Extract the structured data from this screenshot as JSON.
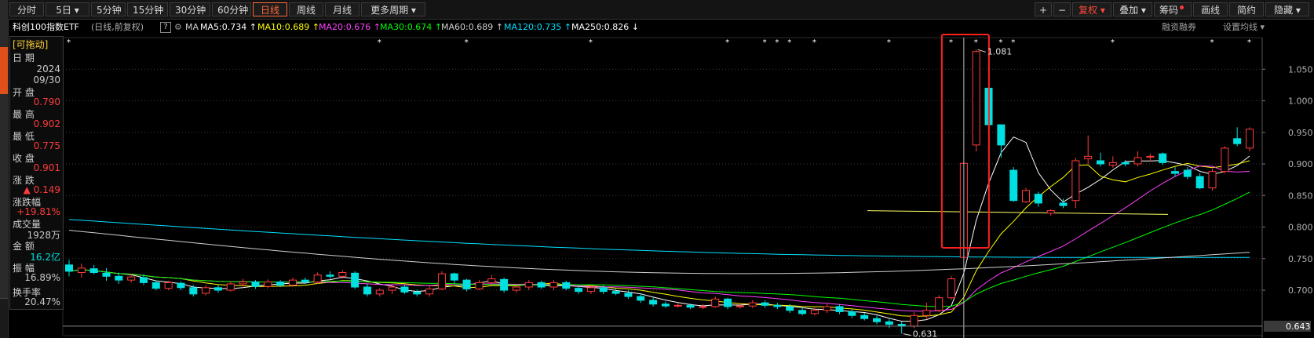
{
  "toolbar": {
    "tabs": [
      {
        "label": "分时"
      },
      {
        "label": "5日 ▾"
      },
      {
        "label": "5分钟"
      },
      {
        "label": "15分钟"
      },
      {
        "label": "30分钟"
      },
      {
        "label": "60分钟"
      },
      {
        "label": "日线",
        "active": true
      },
      {
        "label": "周线"
      },
      {
        "label": "月线"
      },
      {
        "label": "更多周期 ▾"
      }
    ],
    "right": {
      "plus": "+",
      "minus": "−",
      "fuquan": "复权 ▾",
      "diejia": "叠加 ▾",
      "chouma": "筹码",
      "huaxian": "画线",
      "jianyue": "简约",
      "yincang": "隐藏 ▾"
    }
  },
  "ma_line": {
    "title": "科创100指数ETF",
    "subtitle": "(日线,前复权)",
    "help": "?",
    "ma": "MA",
    "items": [
      {
        "text": "MA5:0.734",
        "arrow": "↑",
        "color": "#ffffff"
      },
      {
        "text": "MA10:0.689",
        "arrow": "↑",
        "color": "#ffff00"
      },
      {
        "text": "MA20:0.676",
        "arrow": "↑",
        "color": "#ff40ff"
      },
      {
        "text": "MA30:0.674",
        "arrow": "↑",
        "color": "#00ff00"
      },
      {
        "text": "MA60:0.689",
        "arrow": "↑",
        "color": "#d0d0d0"
      },
      {
        "text": "MA120:0.735",
        "arrow": "↑",
        "color": "#00e0ff"
      },
      {
        "text": "MA250:0.826",
        "arrow": "↓",
        "color": "#ffffff"
      }
    ],
    "rzrq": "融资融券",
    "setma": "设置均线 ▾"
  },
  "info": {
    "drag": "[可拖动]",
    "date_label": "日  期",
    "year": "2024",
    "md": "09/30",
    "open_label": "开  盘",
    "open": "0.790",
    "high_label": "最  高",
    "high": "0.902",
    "low_label": "最  低",
    "low": "0.775",
    "close_label": "收  盘",
    "close": "0.901",
    "chg_label": "涨  跌",
    "chg": "▲ 0.149",
    "pct_label": "涨跌幅",
    "pct": "+19.81%",
    "vol_label": "成交量",
    "vol": "1928万",
    "amt_label": "金  额",
    "amt": "16.2亿",
    "amp_label": "振  幅",
    "amp": "16.89%",
    "turn_label": "换手率",
    "turn": "20.47%"
  },
  "colors": {
    "up": "#ff3b3b",
    "down": "#00e0e0",
    "price_bg": "#3a3a3a",
    "highlight_box": "#ff2020"
  },
  "chart_data": {
    "type": "candlestick",
    "y_ticks": [
      0.7,
      0.75,
      0.8,
      0.85,
      0.9,
      0.95,
      1.0,
      1.05
    ],
    "y_tick_labels": [
      "0.700",
      "0.750",
      "0.800",
      "0.850",
      "0.900",
      "0.950",
      "1.000",
      "1.050"
    ],
    "ylim": [
      0.628,
      1.1
    ],
    "current_price": "0.643",
    "max_label": "1.081",
    "min_label": "0.631",
    "candles": [
      [
        0.74,
        0.73,
        0.748,
        0.722
      ],
      [
        0.728,
        0.735,
        0.742,
        0.72
      ],
      [
        0.734,
        0.728,
        0.74,
        0.725
      ],
      [
        0.727,
        0.722,
        0.735,
        0.715
      ],
      [
        0.722,
        0.716,
        0.728,
        0.71
      ],
      [
        0.716,
        0.721,
        0.726,
        0.712
      ],
      [
        0.72,
        0.712,
        0.725,
        0.708
      ],
      [
        0.712,
        0.703,
        0.716,
        0.7
      ],
      [
        0.703,
        0.712,
        0.715,
        0.7
      ],
      [
        0.711,
        0.704,
        0.714,
        0.7
      ],
      [
        0.704,
        0.694,
        0.708,
        0.69
      ],
      [
        0.695,
        0.704,
        0.708,
        0.692
      ],
      [
        0.704,
        0.7,
        0.708,
        0.696
      ],
      [
        0.7,
        0.71,
        0.714,
        0.698
      ],
      [
        0.71,
        0.713,
        0.718,
        0.706
      ],
      [
        0.713,
        0.706,
        0.716,
        0.702
      ],
      [
        0.706,
        0.713,
        0.717,
        0.703
      ],
      [
        0.713,
        0.708,
        0.716,
        0.705
      ],
      [
        0.708,
        0.716,
        0.72,
        0.706
      ],
      [
        0.716,
        0.713,
        0.72,
        0.71
      ],
      [
        0.713,
        0.724,
        0.728,
        0.71
      ],
      [
        0.724,
        0.722,
        0.73,
        0.718
      ],
      [
        0.722,
        0.728,
        0.732,
        0.718
      ],
      [
        0.727,
        0.705,
        0.73,
        0.702
      ],
      [
        0.705,
        0.694,
        0.71,
        0.69
      ],
      [
        0.694,
        0.7,
        0.703,
        0.69
      ],
      [
        0.7,
        0.705,
        0.708,
        0.694
      ],
      [
        0.705,
        0.697,
        0.708,
        0.694
      ],
      [
        0.697,
        0.694,
        0.701,
        0.69
      ],
      [
        0.694,
        0.702,
        0.706,
        0.69
      ],
      [
        0.702,
        0.726,
        0.73,
        0.7
      ],
      [
        0.726,
        0.716,
        0.728,
        0.71
      ],
      [
        0.716,
        0.702,
        0.718,
        0.698
      ],
      [
        0.702,
        0.712,
        0.716,
        0.7
      ],
      [
        0.712,
        0.718,
        0.724,
        0.708
      ],
      [
        0.717,
        0.7,
        0.72,
        0.696
      ],
      [
        0.7,
        0.705,
        0.708,
        0.696
      ],
      [
        0.705,
        0.712,
        0.716,
        0.7
      ],
      [
        0.712,
        0.705,
        0.715,
        0.702
      ],
      [
        0.705,
        0.712,
        0.716,
        0.7
      ],
      [
        0.712,
        0.703,
        0.715,
        0.7
      ],
      [
        0.703,
        0.698,
        0.708,
        0.694
      ],
      [
        0.698,
        0.704,
        0.708,
        0.694
      ],
      [
        0.704,
        0.698,
        0.708,
        0.694
      ],
      [
        0.698,
        0.695,
        0.702,
        0.692
      ],
      [
        0.695,
        0.69,
        0.7,
        0.686
      ],
      [
        0.69,
        0.684,
        0.694,
        0.68
      ],
      [
        0.684,
        0.678,
        0.688,
        0.674
      ],
      [
        0.678,
        0.675,
        0.682,
        0.672
      ],
      [
        0.675,
        0.676,
        0.68,
        0.672
      ],
      [
        0.676,
        0.673,
        0.679,
        0.67
      ],
      [
        0.673,
        0.674,
        0.678,
        0.67
      ],
      [
        0.674,
        0.686,
        0.69,
        0.672
      ],
      [
        0.686,
        0.674,
        0.688,
        0.67
      ],
      [
        0.674,
        0.675,
        0.68,
        0.671
      ],
      [
        0.675,
        0.68,
        0.684,
        0.672
      ],
      [
        0.68,
        0.676,
        0.684,
        0.672
      ],
      [
        0.676,
        0.674,
        0.68,
        0.67
      ],
      [
        0.674,
        0.668,
        0.678,
        0.664
      ],
      [
        0.668,
        0.663,
        0.672,
        0.66
      ],
      [
        0.663,
        0.668,
        0.672,
        0.66
      ],
      [
        0.668,
        0.674,
        0.678,
        0.664
      ],
      [
        0.674,
        0.666,
        0.678,
        0.662
      ],
      [
        0.666,
        0.66,
        0.67,
        0.656
      ],
      [
        0.66,
        0.655,
        0.664,
        0.652
      ],
      [
        0.655,
        0.65,
        0.66,
        0.646
      ],
      [
        0.65,
        0.646,
        0.654,
        0.64
      ],
      [
        0.646,
        0.643,
        0.65,
        0.631
      ],
      [
        0.643,
        0.66,
        0.665,
        0.64
      ],
      [
        0.66,
        0.668,
        0.68,
        0.655
      ],
      [
        0.668,
        0.688,
        0.692,
        0.665
      ],
      [
        0.688,
        0.718,
        0.722,
        0.685
      ],
      [
        0.752,
        0.901,
        0.902,
        0.775
      ],
      [
        0.93,
        1.078,
        1.081,
        0.92
      ],
      [
        1.02,
        0.962,
        1.03,
        0.91
      ],
      [
        0.962,
        0.93,
        0.96,
        0.91
      ],
      [
        0.89,
        0.842,
        0.895,
        0.84
      ],
      [
        0.84,
        0.858,
        0.862,
        0.838
      ],
      [
        0.852,
        0.838,
        0.856,
        0.832
      ],
      [
        0.822,
        0.826,
        0.828,
        0.818
      ],
      [
        0.838,
        0.834,
        0.845,
        0.83
      ],
      [
        0.842,
        0.905,
        0.91,
        0.83
      ],
      [
        0.908,
        0.912,
        0.945,
        0.9
      ],
      [
        0.905,
        0.9,
        0.918,
        0.896
      ],
      [
        0.898,
        0.902,
        0.912,
        0.894
      ],
      [
        0.902,
        0.9,
        0.906,
        0.896
      ],
      [
        0.9,
        0.91,
        0.92,
        0.896
      ],
      [
        0.912,
        0.912,
        0.916,
        0.904
      ],
      [
        0.916,
        0.902,
        0.918,
        0.898
      ],
      [
        0.888,
        0.885,
        0.895,
        0.88
      ],
      [
        0.89,
        0.88,
        0.895,
        0.876
      ],
      [
        0.88,
        0.862,
        0.885,
        0.86
      ],
      [
        0.862,
        0.888,
        0.892,
        0.858
      ],
      [
        0.888,
        0.925,
        0.928,
        0.885
      ],
      [
        0.94,
        0.932,
        0.958,
        0.928
      ],
      [
        0.925,
        0.955,
        0.958,
        0.92
      ]
    ]
  }
}
